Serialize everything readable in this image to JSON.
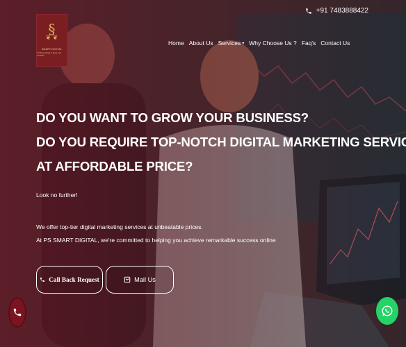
{
  "topbar": {
    "phone": "+91 7483888422"
  },
  "logo": {
    "brand": "SMART DIGITAL",
    "tagline": "Thinking ahead to grow your benefits!"
  },
  "nav": {
    "items": [
      {
        "label": "Home"
      },
      {
        "label": "About Us"
      },
      {
        "label": "Services"
      },
      {
        "label": "Why Choose Us ?"
      },
      {
        "label": "Faq's"
      },
      {
        "label": "Contact Us"
      }
    ]
  },
  "hero": {
    "headline_lines": [
      "DO YOU WANT TO GROW YOUR BUSINESS?",
      "DO YOU REQUIRE TOP-NOTCH DIGITAL MARKETING SERVICES",
      "AT AFFORDABLE PRICE?"
    ],
    "lead": "Look no further!",
    "paragraph_1": "We offer top-tier digital marketing services at unbeatable prices.",
    "paragraph_2": "At PS SMART DIGITAL, we're committed to helping you achieve remarkable success online"
  },
  "buttons": {
    "call": "Call Back Request",
    "mail": "Mail Us"
  },
  "colors": {
    "brand_red": "#7b1e22",
    "whatsapp": "#25d366",
    "accent_gold": "#d8b45c"
  }
}
